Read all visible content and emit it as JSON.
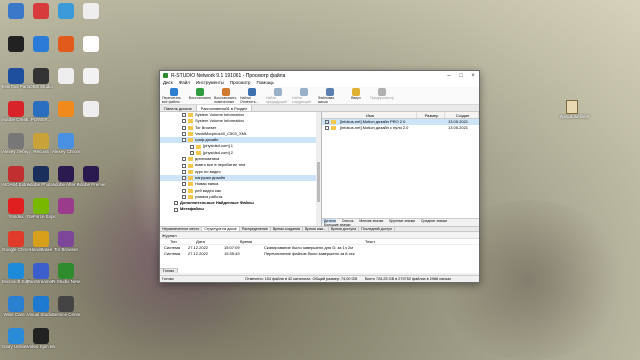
{
  "desktop": {
    "icons": [
      {
        "label": "",
        "color": "#3a78c9",
        "col": 0,
        "row": 0
      },
      {
        "label": "",
        "color": "#d83b3b",
        "col": 1,
        "row": 0
      },
      {
        "label": "",
        "color": "#3b9bd8",
        "col": 2,
        "row": 0
      },
      {
        "label": "",
        "color": "#eeeeee",
        "col": 3,
        "row": 0
      },
      {
        "label": "",
        "color": "#222222",
        "col": 0,
        "row": 1
      },
      {
        "label": "",
        "color": "#2b7cd8",
        "col": 1,
        "row": 1
      },
      {
        "label": "",
        "color": "#e05b1b",
        "col": 2,
        "row": 1
      },
      {
        "label": "",
        "color": "#ffffff",
        "col": 3,
        "row": 1
      },
      {
        "label": "MiniTool Partition...",
        "color": "#1e4f9c",
        "col": 0,
        "row": 2
      },
      {
        "label": "OBS Studio",
        "color": "#333333",
        "col": 1,
        "row": 2
      },
      {
        "label": "",
        "color": "#eeeeee",
        "col": 2,
        "row": 2
      },
      {
        "label": "",
        "color": "#f2f2f2",
        "col": 3,
        "row": 2
      },
      {
        "label": "Adobe Creati...",
        "color": "#d8232a",
        "col": 0,
        "row": 3
      },
      {
        "label": "POWER...",
        "color": "#2a6fbf",
        "col": 1,
        "row": 3
      },
      {
        "label": "",
        "color": "#f08a1c",
        "col": 2,
        "row": 3
      },
      {
        "label": "",
        "color": "#eeeeee",
        "col": 3,
        "row": 3
      },
      {
        "label": "Alexey Лебедев...",
        "color": "#777777",
        "col": 0,
        "row": 4
      },
      {
        "label": "Recuva",
        "color": "#c9a23a",
        "col": 1,
        "row": 4
      },
      {
        "label": "Alexey Chrome",
        "color": "#4a90e2",
        "col": 2,
        "row": 4
      },
      {
        "label": "AIDA64 Extreme",
        "color": "#c03030",
        "col": 0,
        "row": 5
      },
      {
        "label": "Adobe Photosh...",
        "color": "#1a2f5c",
        "col": 1,
        "row": 5
      },
      {
        "label": "Adobe After Effects 2021",
        "color": "#2b1a4f",
        "col": 2,
        "row": 5
      },
      {
        "label": "Adobe Premie...",
        "color": "#2b1a4f",
        "col": 3,
        "row": 5
      },
      {
        "label": "Yandex",
        "color": "#e02020",
        "col": 0,
        "row": 6
      },
      {
        "label": "GeForce Experience",
        "color": "#76b900",
        "col": 1,
        "row": 6
      },
      {
        "label": "",
        "color": "#9b3b8b",
        "col": 2,
        "row": 6
      },
      {
        "label": "Google Chrome",
        "color": "#e03a2a",
        "col": 0,
        "row": 7
      },
      {
        "label": "HandBrake",
        "color": "#d8a01a",
        "col": 1,
        "row": 7
      },
      {
        "label": "Tor Browser",
        "color": "#7d4698",
        "col": 2,
        "row": 7
      },
      {
        "label": "Microsoft Edge",
        "color": "#1b8ad8",
        "col": 0,
        "row": 8
      },
      {
        "label": "PanStreamer...",
        "color": "#3a5fcc",
        "col": 1,
        "row": 8
      },
      {
        "label": "R-Studio Network",
        "color": "#2e8b2e",
        "col": 2,
        "row": 8
      },
      {
        "label": "Wise Care...",
        "color": "#2a7fd0",
        "col": 0,
        "row": 9
      },
      {
        "label": "Visual Studio Code",
        "color": "#1e7ad1",
        "col": 1,
        "row": 9
      },
      {
        "label": "Service Center",
        "color": "#444444",
        "col": 2,
        "row": 9
      },
      {
        "label": "Glary Utilities 5",
        "color": "#2a8ad8",
        "col": 0,
        "row": 10
      },
      {
        "label": "Video Spin Blaster",
        "color": "#222222",
        "col": 1,
        "row": 10
      }
    ],
    "file_icon_label": "ярлык.website"
  },
  "window": {
    "title": "R-STUDIO Network 9.1 191061 - Просмотр файла",
    "menu": [
      "Диск",
      "Файл",
      "Инструменты",
      "Просмотр",
      "Помощь"
    ],
    "toolbar": [
      {
        "label": "Перечитать все файлы",
        "color": "#2f7fd0",
        "disabled": false
      },
      {
        "label": "Восстановить",
        "color": "#2e9b3e",
        "disabled": false
      },
      {
        "label": "Восстановить помеченные",
        "color": "#d07a2f",
        "disabled": false
      },
      {
        "label": "Найти/Отметить...",
        "color": "#3a6fb0",
        "disabled": false
      },
      {
        "label": "Найти предыдущий",
        "color": "#9ab0c8",
        "disabled": true
      },
      {
        "label": "Найти следующий",
        "color": "#9ab0c8",
        "disabled": true
      },
      {
        "label": "Файловая маска",
        "color": "#5a7fb0",
        "disabled": false
      },
      {
        "label": "Вверх",
        "color": "#e0b030",
        "disabled": false
      },
      {
        "label": "Предпросмотр",
        "color": "#b0b0b0",
        "disabled": true
      }
    ],
    "top_tabs": [
      "Панель дисков",
      "Распознанный1 в Раздел"
    ],
    "tree": [
      {
        "label": "System Volume Information",
        "indent": 22,
        "folder": true,
        "sel": false
      },
      {
        "label": "System Volume Information",
        "indent": 22,
        "folder": true,
        "sel": false
      },
      {
        "label": "Tor Browser",
        "indent": 22,
        "folder": true,
        "sel": false
      },
      {
        "label": "VanhiMorphus40_C503_XML",
        "indent": 22,
        "folder": true,
        "sel": false
      },
      {
        "label": "граф.дизайн",
        "indent": 22,
        "folder": true,
        "sel": true
      },
      {
        "label": "[рhysldsd.com] 1",
        "indent": 30,
        "folder": true,
        "sel": false
      },
      {
        "label": "[рhysldsd.com] 2",
        "indent": 30,
        "folder": true,
        "sel": false
      },
      {
        "label": "дипломатика",
        "indent": 22,
        "folder": true,
        "sel": false
      },
      {
        "label": "имиго все в перебитие тем",
        "indent": 22,
        "folder": true,
        "sel": false
      },
      {
        "label": "курс по видео",
        "indent": 22,
        "folder": true,
        "sel": false
      },
      {
        "label": "нагрузки дизайн",
        "indent": 22,
        "folder": true,
        "sel": true
      },
      {
        "label": "Новая папка",
        "indent": 22,
        "folder": true,
        "sel": false
      },
      {
        "label": "рей видео как",
        "indent": 22,
        "folder": true,
        "sel": false
      },
      {
        "label": "учимся работа",
        "indent": 22,
        "folder": true,
        "sel": false
      },
      {
        "label": "Дополнительные Найденные Файлы",
        "indent": 14,
        "folder": false,
        "sel": false
      },
      {
        "label": "Метафайлы",
        "indent": 14,
        "folder": false,
        "sel": false
      }
    ],
    "list_columns": [
      "Имя",
      "Размер",
      "Создан"
    ],
    "list_rows": [
      {
        "name": "[infokus.net] Motion дизайн PRO 2.0",
        "size": "",
        "created": "13.05.2021",
        "sel": true
      },
      {
        "name": "[infokus.net] Motion дизайн с нуля 2.0",
        "size": "",
        "created": "13.05.2021",
        "sel": false
      }
    ],
    "view_options": [
      {
        "label": "Детали",
        "act": true
      },
      {
        "label": "Список",
        "act": false
      },
      {
        "label": "Мелкие значки",
        "act": false
      },
      {
        "label": "Крупные значки",
        "act": false
      },
      {
        "label": "Средние значки",
        "act": false
      },
      {
        "label": "Большие значки",
        "act": false
      }
    ],
    "bottom_tabs": [
      "Неразмеченное место",
      "Структура на диске",
      "Распределение",
      "Время создания",
      "Время изм...",
      "Время доступа",
      "Последний доступ"
    ],
    "bottom_tab_active": 1,
    "log": {
      "title": "Журнал",
      "columns": [
        "Тип",
        "Дата",
        "Время",
        "Текст"
      ],
      "rows": [
        {
          "type": "Система",
          "date": "27.12.2022",
          "time": "15:07:09",
          "text": "Сканирование было завершено для D: за 1ч 2м"
        },
        {
          "type": "Система",
          "date": "27.12.2022",
          "time": "15:35:49",
          "text": "Перечисление файлов было завершено за 8 сек"
        }
      ],
      "tab": "Готово"
    },
    "status": {
      "ready": "Готово",
      "marked": "Отмечено: 154 файла в 42 каталогах. Общий размер: 74,00 GB",
      "total": "Всего 726,25 GB в 279752 файлах в 2968 папках"
    }
  }
}
